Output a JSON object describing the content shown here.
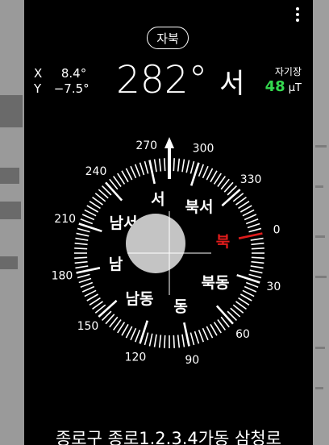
{
  "toolbar": {
    "menu_icon": "more-vertical-icon"
  },
  "north_mode_label": "자북",
  "axis_x": {
    "label": "X",
    "value": "8.4°"
  },
  "axis_y": {
    "label": "Y",
    "value": "−7.5°"
  },
  "heading": {
    "degrees": "282°",
    "direction": "서"
  },
  "magnetic": {
    "label": "자기장",
    "value": "48",
    "unit": "μT"
  },
  "compass": {
    "heading_deg": 282,
    "degree_labels": [
      "0",
      "30",
      "60",
      "90",
      "120",
      "150",
      "180",
      "210",
      "240",
      "270",
      "300",
      "330"
    ],
    "direction_labels": [
      {
        "text": "북",
        "angle": 0,
        "color": "#e01c1c"
      },
      {
        "text": "북동",
        "angle": 45
      },
      {
        "text": "동",
        "angle": 90
      },
      {
        "text": "남동",
        "angle": 135
      },
      {
        "text": "남",
        "angle": 180
      },
      {
        "text": "남서",
        "angle": 225
      },
      {
        "text": "서",
        "angle": 270
      },
      {
        "text": "북서",
        "angle": 315
      }
    ],
    "north_tick_color": "#e01c1c",
    "level_bubble_color": "#c4c4c4"
  },
  "address": "종로구 종로1.2.3.4가동 삼청로"
}
